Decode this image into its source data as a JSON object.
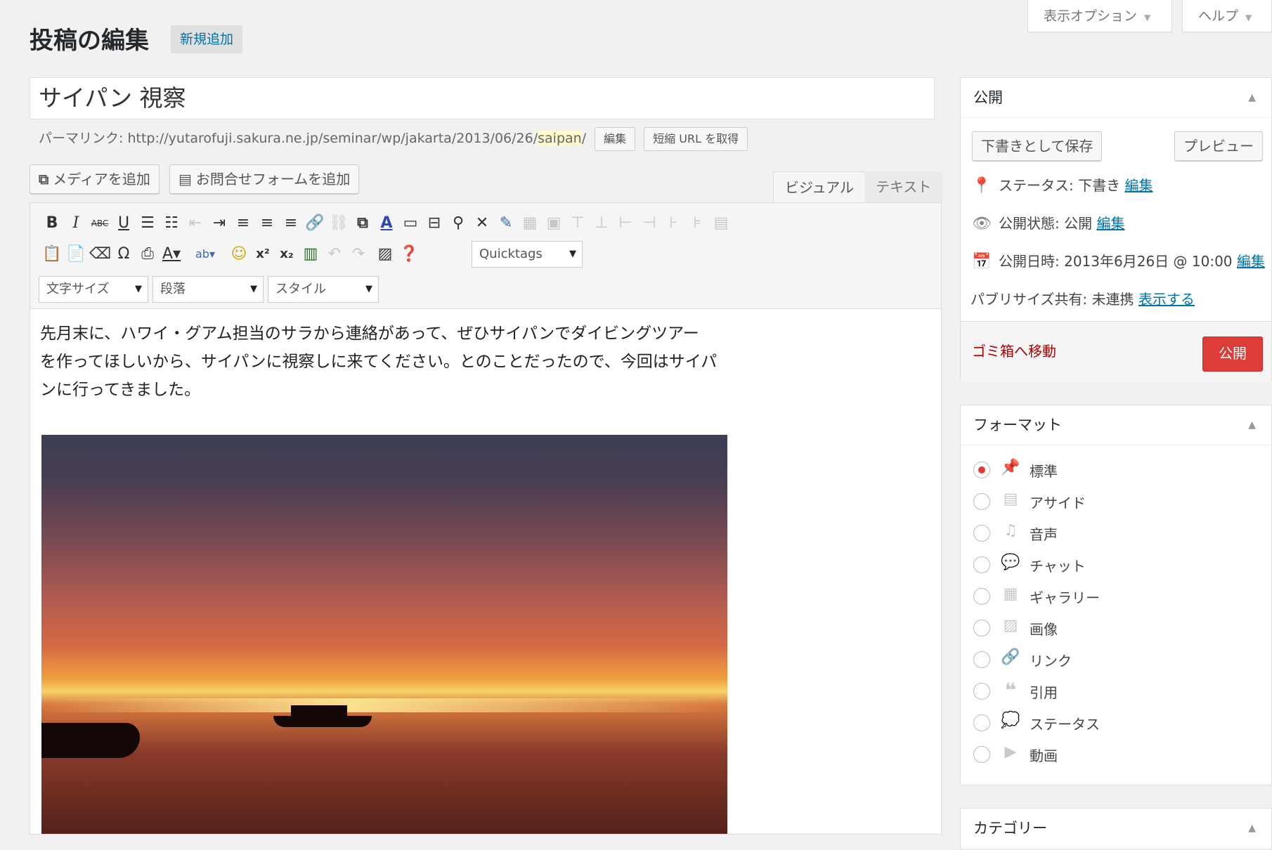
{
  "header": {
    "screen_options": "表示オプション",
    "help": "ヘルプ",
    "page_title": "投稿の編集",
    "add_new": "新規追加"
  },
  "post": {
    "title": "サイパン 視察",
    "permalink_label": "パーマリンク:",
    "permalink_base": "http://yutarofuji.sakura.ne.jp/seminar/wp/jakarta/2013/06/26/",
    "permalink_slug": "saipan",
    "permalink_tail": "/",
    "edit_btn": "編集",
    "shortlink_btn": "短縮 URL を取得"
  },
  "media": {
    "add_media": "メディアを追加",
    "add_form": "お問合せフォームを追加"
  },
  "editor_tabs": {
    "visual": "ビジュアル",
    "text": "テキスト"
  },
  "toolbar": {
    "quicktags": "Quicktags",
    "font_size": "文字サイズ",
    "paragraph": "段落",
    "style": "スタイル"
  },
  "content": {
    "line1": "先月末に、ハワイ・グアム担当のサラから連絡があって、ぜひサイパンでダイビングツアー",
    "line2": "を作ってほしいから、サイパンに視察しに来てください。とのことだったので、今回はサイパ",
    "line3": "ンに行ってきました。"
  },
  "publish": {
    "heading": "公開",
    "save_draft": "下書きとして保存",
    "preview": "プレビュー",
    "status_label": "ステータス: 下書き",
    "visibility_label": "公開状態: 公開",
    "date_label": "公開日時: 2013年6月26日 @ 10:00",
    "edit": "編集",
    "publicize_label": "パブリサイズ共有: 未連携",
    "publicize_link": "表示する",
    "trash": "ゴミ箱へ移動",
    "publish_btn": "公開"
  },
  "format": {
    "heading": "フォーマット",
    "options": [
      "標準",
      "アサイド",
      "音声",
      "チャット",
      "ギャラリー",
      "画像",
      "リンク",
      "引用",
      "ステータス",
      "動画"
    ]
  },
  "category": {
    "heading": "カテゴリー"
  }
}
